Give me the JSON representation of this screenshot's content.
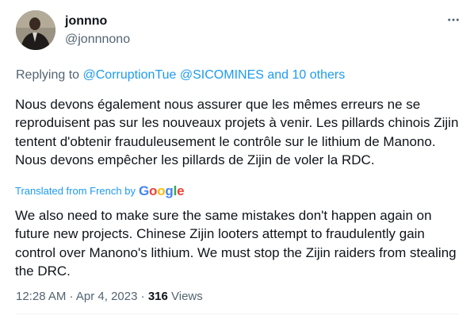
{
  "author": {
    "display_name": "jonnno",
    "handle": "@jonnnono"
  },
  "reply": {
    "prefix": "Replying to",
    "mention_1": "@CorruptionTue",
    "mention_2": "@SICOMINES",
    "others": "and 10 others"
  },
  "tweet": {
    "text": "Nous devons également nous assurer que les mêmes erreurs ne se reproduisent pas sur les nouveaux projets à venir. Les pillards chinois Zijin tentent d'obtenir frauduleusement le contrôle sur le lithium de Manono. Nous devons empêcher les pillards de Zijin de voler la RDC.",
    "translated_label": "Translated from French by",
    "translation_provider": "Google",
    "translation": "We also need to make sure the same mistakes don't happen again on future new projects. Chinese Zijin looters attempt to fraudulently gain control over Manono's lithium. We must stop the Zijin raiders from stealing the DRC."
  },
  "meta": {
    "time": "12:28 AM",
    "separator": " · ",
    "date": "Apr 4, 2023",
    "views_count": "316",
    "views_label": " Views"
  },
  "icons": {
    "more": "more-horizontal-icon"
  },
  "colors": {
    "link": "#1d9bf0",
    "secondary_text": "#536471",
    "primary_text": "#0f1419"
  }
}
